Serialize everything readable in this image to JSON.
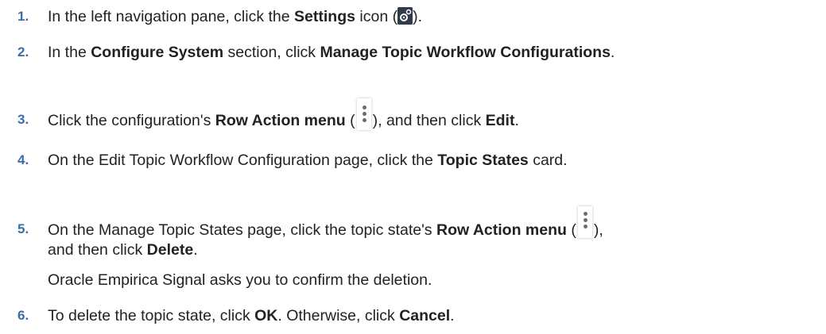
{
  "steps": [
    {
      "number": "1.",
      "t1": "In the left navigation pane, click the ",
      "b1": "Settings",
      "t2": " icon (",
      "t3": ")."
    },
    {
      "number": "2.",
      "t1": "In the ",
      "b1": "Configure System",
      "t2": " section, click ",
      "b2": "Manage Topic Workflow Configurations",
      "t3": "."
    },
    {
      "number": "3.",
      "t1": "Click the configuration's ",
      "b1": "Row Action menu",
      "t2": " (",
      "t3": "), and then click ",
      "b2": "Edit",
      "t4": "."
    },
    {
      "number": "4.",
      "t1": "On the Edit Topic Workflow Configuration page, click the ",
      "b1": "Topic States",
      "t2": " card."
    },
    {
      "number": "5.",
      "t1": "On the Manage Topic States page, click the topic state's ",
      "b1": "Row Action menu",
      "t2": " (",
      "t3": "),",
      "t4": "and then click ",
      "b2": "Delete",
      "t5": ".",
      "note": "Oracle Empirica Signal asks you to confirm the deletion."
    },
    {
      "number": "6.",
      "t1": "To delete the topic state, click ",
      "b1": "OK",
      "t2": ". Otherwise, click ",
      "b2": "Cancel",
      "t3": "."
    }
  ],
  "icons": {
    "settings": "settings-gear-icon",
    "row_action": "vertical-ellipsis-icon"
  }
}
